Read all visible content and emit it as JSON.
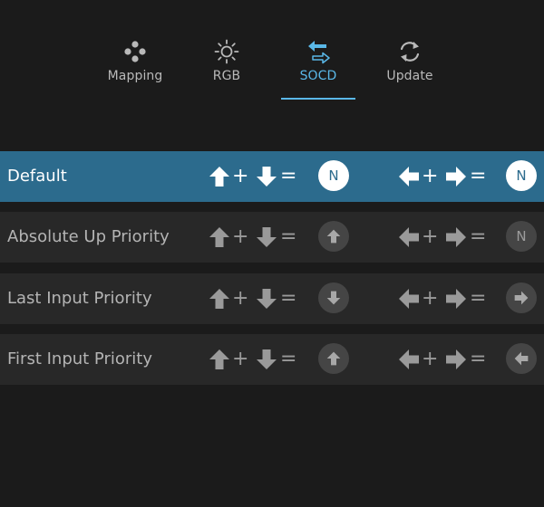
{
  "colors": {
    "background": "#1b1b1b",
    "row_background": "#282828",
    "selected_row_background": "#2c6b8d",
    "accent": "#5ab8e8",
    "icon_gray": "#9a9a9a",
    "text_gray": "#b4b4b4",
    "circle_gray": "#454545"
  },
  "tabs": [
    {
      "label": "Mapping",
      "icon": "gamepad-icon",
      "active": false
    },
    {
      "label": "RGB",
      "icon": "sun-icon",
      "active": false
    },
    {
      "label": "SOCD",
      "icon": "socd-arrows-icon",
      "active": true
    },
    {
      "label": "Update",
      "icon": "refresh-icon",
      "active": false
    }
  ],
  "equation": {
    "plus": "+",
    "equals": "="
  },
  "modes": [
    {
      "label": "Default",
      "selected": true,
      "vertical_result": {
        "type": "text",
        "text": "N",
        "icon": "neutral-badge"
      },
      "horizontal_result": {
        "type": "text",
        "text": "N",
        "icon": "neutral-badge"
      }
    },
    {
      "label": "Absolute Up Priority",
      "selected": false,
      "vertical_result": {
        "type": "icon",
        "text": "",
        "icon": "arrow-up-icon"
      },
      "horizontal_result": {
        "type": "text",
        "text": "N",
        "icon": "neutral-badge"
      }
    },
    {
      "label": "Last Input Priority",
      "selected": false,
      "vertical_result": {
        "type": "icon",
        "text": "",
        "icon": "arrow-down-icon"
      },
      "horizontal_result": {
        "type": "icon",
        "text": "",
        "icon": "arrow-right-icon"
      }
    },
    {
      "label": "First Input Priority",
      "selected": false,
      "vertical_result": {
        "type": "icon",
        "text": "",
        "icon": "arrow-up-icon"
      },
      "horizontal_result": {
        "type": "icon",
        "text": "",
        "icon": "arrow-left-icon"
      }
    }
  ]
}
